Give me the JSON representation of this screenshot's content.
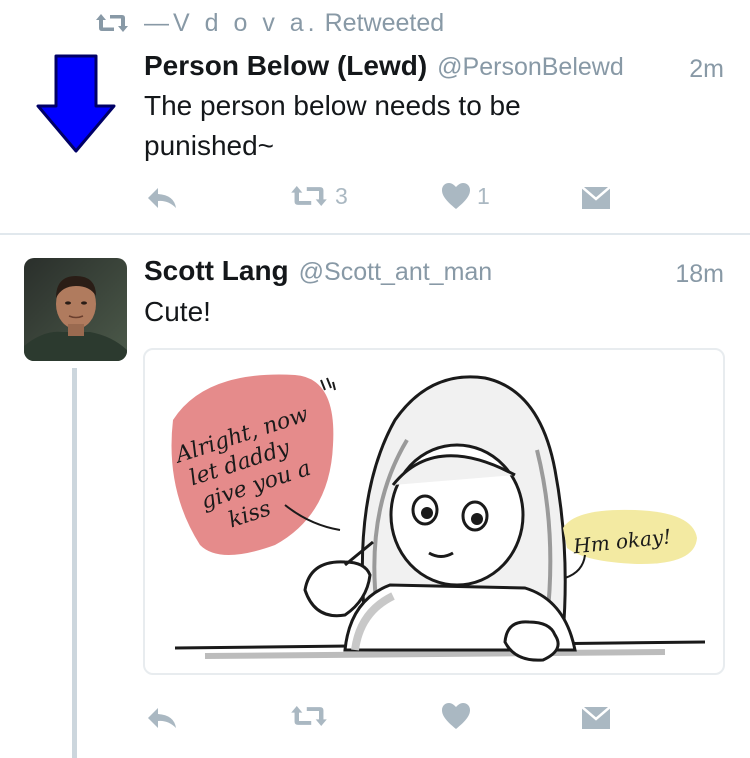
{
  "retweet_header": {
    "icon": "retweet-icon",
    "dash": "—",
    "retweeter": "V d o v a.",
    "label": "Retweeted"
  },
  "tweet1": {
    "avatar_icon": "down-arrow-icon",
    "avatar_color": "#0000ff",
    "name": "Person Below (Lewd)",
    "handle": "@PersonBelewd",
    "time": "2m",
    "text_line1": "The person below needs to be",
    "text_line2": "punished~",
    "actions": {
      "reply_icon": "reply-icon",
      "retweet_icon": "retweet-icon",
      "retweet_count": "3",
      "like_icon": "heart-icon",
      "like_count": "1",
      "dm_icon": "envelope-icon"
    }
  },
  "tweet2": {
    "avatar_icon": "profile-photo",
    "name": "Scott Lang",
    "handle": "@Scott_ant_man",
    "time": "18m",
    "text": "Cute!",
    "media": {
      "bubble_left_lines": [
        "Alright, now",
        "let daddy",
        "give you a",
        "kiss"
      ],
      "bubble_left_color": "#e58b8b",
      "bubble_right": "Hm okay!",
      "bubble_right_color": "#f3eaa2"
    },
    "actions": {
      "reply_icon": "reply-icon",
      "retweet_icon": "retweet-icon",
      "like_icon": "heart-icon",
      "dm_icon": "envelope-icon"
    }
  },
  "colors": {
    "text": "#14171a",
    "muted": "#8899a6",
    "icon": "#aab8c2",
    "divider": "#e1e8ed"
  }
}
